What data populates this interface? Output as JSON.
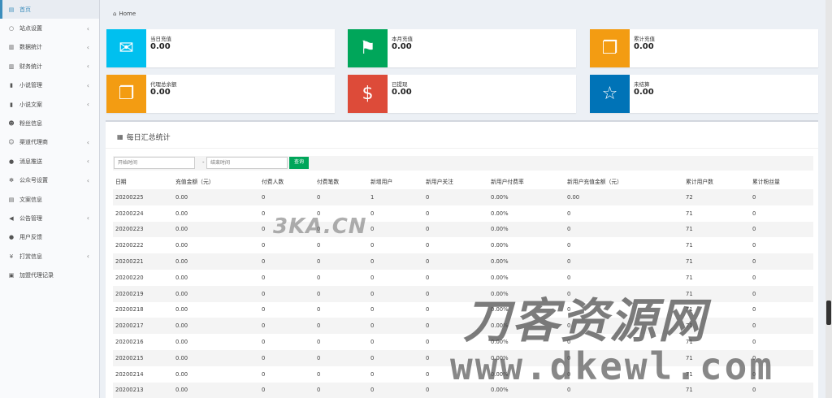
{
  "sidebar": {
    "items": [
      {
        "label": "首页",
        "icon": "dashboard-icon",
        "glyph": "▤",
        "chevron": false,
        "active": true
      },
      {
        "label": "站点设置",
        "icon": "circle-icon",
        "glyph": "○",
        "chevron": true
      },
      {
        "label": "数据统计",
        "icon": "bar-chart-icon",
        "glyph": "▥",
        "chevron": true
      },
      {
        "label": "财务统计",
        "icon": "bar-chart-icon",
        "glyph": "▥",
        "chevron": true
      },
      {
        "label": "小说管理",
        "icon": "book-icon",
        "glyph": "▮",
        "chevron": true
      },
      {
        "label": "小说文案",
        "icon": "book-icon",
        "glyph": "▮",
        "chevron": true
      },
      {
        "label": "粉丝信息",
        "icon": "users-icon",
        "glyph": "☻",
        "chevron": false
      },
      {
        "label": "渠道代理商",
        "icon": "user-plus-icon",
        "glyph": "☺",
        "chevron": true
      },
      {
        "label": "消息推送",
        "icon": "comment-icon",
        "glyph": "●",
        "chevron": true
      },
      {
        "label": "公众号设置",
        "icon": "gears-icon",
        "glyph": "✻",
        "chevron": true
      },
      {
        "label": "文案信息",
        "icon": "list-icon",
        "glyph": "▤",
        "chevron": false
      },
      {
        "label": "公告管理",
        "icon": "bullhorn-icon",
        "glyph": "◀",
        "chevron": true
      },
      {
        "label": "用户反馈",
        "icon": "comment-icon",
        "glyph": "●",
        "chevron": false
      },
      {
        "label": "打赏信息",
        "icon": "yen-icon",
        "glyph": "¥",
        "chevron": true
      },
      {
        "label": "加盟代理记录",
        "icon": "id-card-icon",
        "glyph": "▣",
        "chevron": false
      }
    ]
  },
  "breadcrumb": {
    "home": "Home"
  },
  "info_boxes": [
    {
      "label": "当日充值",
      "value": "0.00",
      "color": "#00c0ef",
      "icon": "envelope-icon",
      "glyph": "✉"
    },
    {
      "label": "本月充值",
      "value": "0.00",
      "color": "#00a65a",
      "icon": "flag-icon",
      "glyph": "⚑"
    },
    {
      "label": "累计充值",
      "value": "0.00",
      "color": "#f39c12",
      "icon": "copy-icon",
      "glyph": "❐"
    },
    {
      "label": "代理总余额",
      "value": "0.00",
      "color": "#f39c12",
      "icon": "copy-icon",
      "glyph": "❐"
    },
    {
      "label": "已提现",
      "value": "0.00",
      "color": "#dd4b39",
      "icon": "dollar-icon",
      "glyph": "$"
    },
    {
      "label": "未结算",
      "value": "0.00",
      "color": "#0073b7",
      "icon": "star-icon",
      "glyph": "☆"
    }
  ],
  "panel": {
    "title": "每日汇总统计",
    "start_placeholder": "开始时间",
    "end_placeholder": "结束时间",
    "separator": "-",
    "query_label": "查询"
  },
  "table": {
    "headers": [
      "日期",
      "充值金额（元）",
      "付费人数",
      "付费笔数",
      "新增用户",
      "新用户关注",
      "新用户付费率",
      "新用户充值金额（元）",
      "累计用户数",
      "累计粉丝量"
    ],
    "rows": [
      [
        "20200225",
        "0.00",
        "0",
        "0",
        "1",
        "0",
        "0.00%",
        "0.00",
        "72",
        "0"
      ],
      [
        "20200224",
        "0.00",
        "0",
        "0",
        "0",
        "0",
        "0.00%",
        "0",
        "71",
        "0"
      ],
      [
        "20200223",
        "0.00",
        "0",
        "0",
        "0",
        "0",
        "0.00%",
        "0",
        "71",
        "0"
      ],
      [
        "20200222",
        "0.00",
        "0",
        "0",
        "0",
        "0",
        "0.00%",
        "0",
        "71",
        "0"
      ],
      [
        "20200221",
        "0.00",
        "0",
        "0",
        "0",
        "0",
        "0.00%",
        "0",
        "71",
        "0"
      ],
      [
        "20200220",
        "0.00",
        "0",
        "0",
        "0",
        "0",
        "0.00%",
        "0",
        "71",
        "0"
      ],
      [
        "20200219",
        "0.00",
        "0",
        "0",
        "0",
        "0",
        "0.00%",
        "0",
        "71",
        "0"
      ],
      [
        "20200218",
        "0.00",
        "0",
        "0",
        "0",
        "0",
        "0.00%",
        "0",
        "71",
        "0"
      ],
      [
        "20200217",
        "0.00",
        "0",
        "0",
        "0",
        "0",
        "0.00%",
        "0",
        "71",
        "0"
      ],
      [
        "20200216",
        "0.00",
        "0",
        "0",
        "0",
        "0",
        "0.00%",
        "0",
        "71",
        "0"
      ],
      [
        "20200215",
        "0.00",
        "0",
        "0",
        "0",
        "0",
        "0.00%",
        "0",
        "71",
        "0"
      ],
      [
        "20200214",
        "0.00",
        "0",
        "0",
        "0",
        "0",
        "0.00%",
        "0",
        "71",
        "0"
      ],
      [
        "20200213",
        "0.00",
        "0",
        "0",
        "0",
        "0",
        "0.00%",
        "0",
        "71",
        "0"
      ]
    ]
  },
  "watermarks": {
    "small": "3KA.CN",
    "brand": "刀客资源网",
    "url": "www.dkewl.com"
  }
}
